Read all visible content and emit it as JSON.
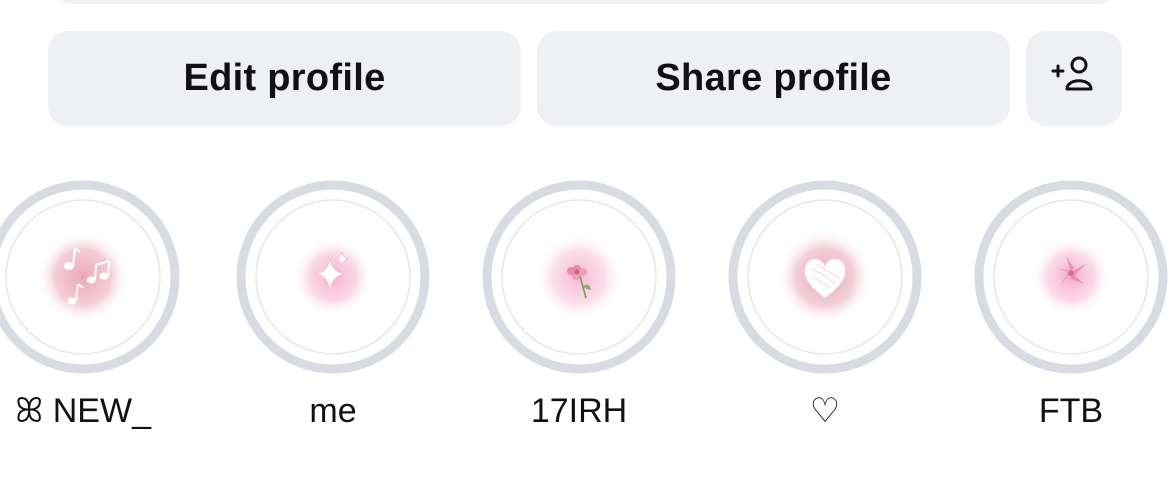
{
  "actions": {
    "edit_label": "Edit profile",
    "share_label": "Share profile",
    "add_friend_icon": "person-add-icon"
  },
  "highlights": [
    {
      "label": "ꕤ NEW_",
      "icon": "music-notes-icon",
      "glow": "#e9a3b6"
    },
    {
      "label": "me",
      "icon": "sparkles-icon",
      "glow": "#f2a9c6"
    },
    {
      "label": "17IRH",
      "icon": "flower-icon",
      "glow": "#f6b4cf"
    },
    {
      "label": "♡",
      "icon": "heart-icon",
      "glow": "#e4a0b3"
    },
    {
      "label": "FTB",
      "icon": "lily-icon",
      "glow": "#f4a6c7"
    }
  ],
  "colors": {
    "button_bg": "#eff0f3",
    "ring": "#d9dbe2",
    "text": "#111111"
  }
}
